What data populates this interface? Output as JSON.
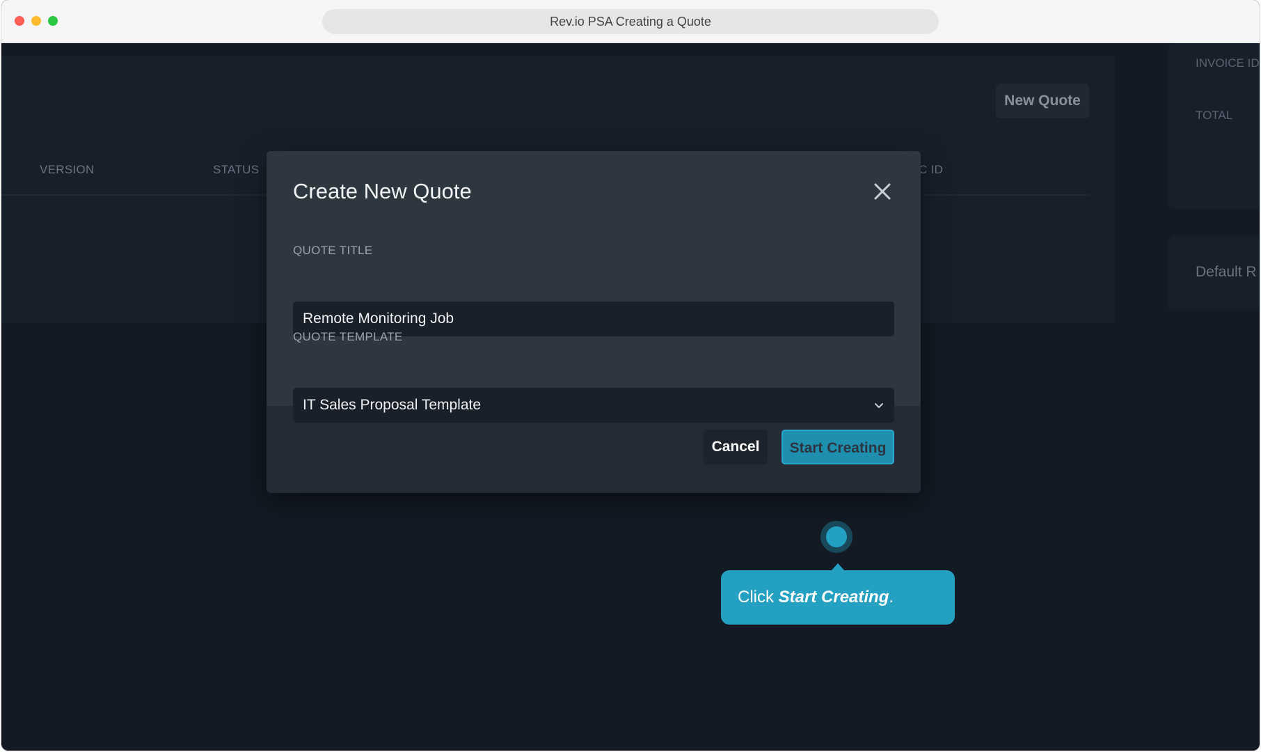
{
  "window": {
    "title": "Rev.io PSA Creating a Quote"
  },
  "background": {
    "new_quote_label": "New Quote",
    "columns": [
      "VERSION",
      "STATUS",
      "C ID"
    ],
    "side": {
      "invoice_id_label": "INVOICE ID",
      "total_label": "TOTAL",
      "default_value": "Default R"
    }
  },
  "modal": {
    "title": "Create New Quote",
    "quote_title_label": "QUOTE TITLE",
    "quote_title_value": "Remote Monitoring Job",
    "quote_template_label": "QUOTE TEMPLATE",
    "quote_template_value": "IT Sales Proposal Template",
    "cancel_label": "Cancel",
    "start_label": "Start Creating"
  },
  "tooltip": {
    "prefix": "Click ",
    "emphasis": "Start Creating",
    "suffix": "."
  },
  "colors": {
    "accent": "#23a0c2",
    "background": "#131a23",
    "modal": "#2e3640"
  }
}
